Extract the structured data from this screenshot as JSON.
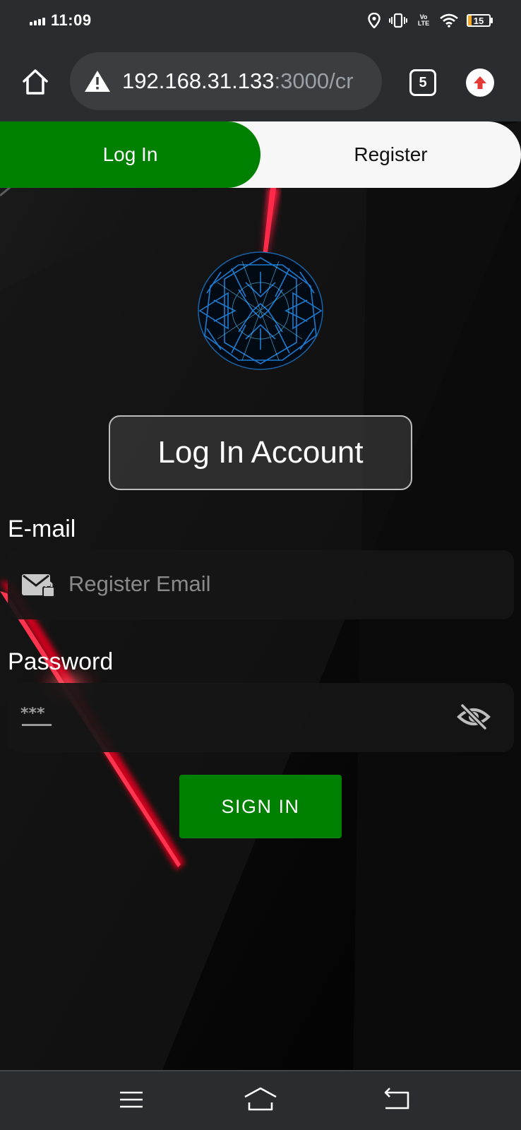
{
  "status_bar": {
    "time": "11:09",
    "lte_label": "Vo LTE",
    "battery_level": "15",
    "icons": [
      "signal-icon",
      "location-icon",
      "vibrate-icon",
      "wifi-icon",
      "battery-icon"
    ]
  },
  "browser": {
    "url_host": "192.168.31.133",
    "url_rest": ":3000/cr",
    "tab_count": "5",
    "icons": [
      "home-icon",
      "warning-icon",
      "update-icon"
    ]
  },
  "auth_tabs": {
    "login_label": "Log In",
    "register_label": "Register",
    "active": "login"
  },
  "heading": "Log In Account",
  "email": {
    "label": "E-mail",
    "placeholder": "Register Email"
  },
  "password": {
    "label": "Password"
  },
  "signin_label": "SIGN IN",
  "colors": {
    "accent_green": "#008000",
    "browser_chrome": "#2b2c30",
    "logo_blue": "#1e88e5",
    "laser_red": "#e0002a"
  },
  "nav": {
    "icons": [
      "menu-icon",
      "home-nav-icon",
      "back-icon"
    ]
  }
}
